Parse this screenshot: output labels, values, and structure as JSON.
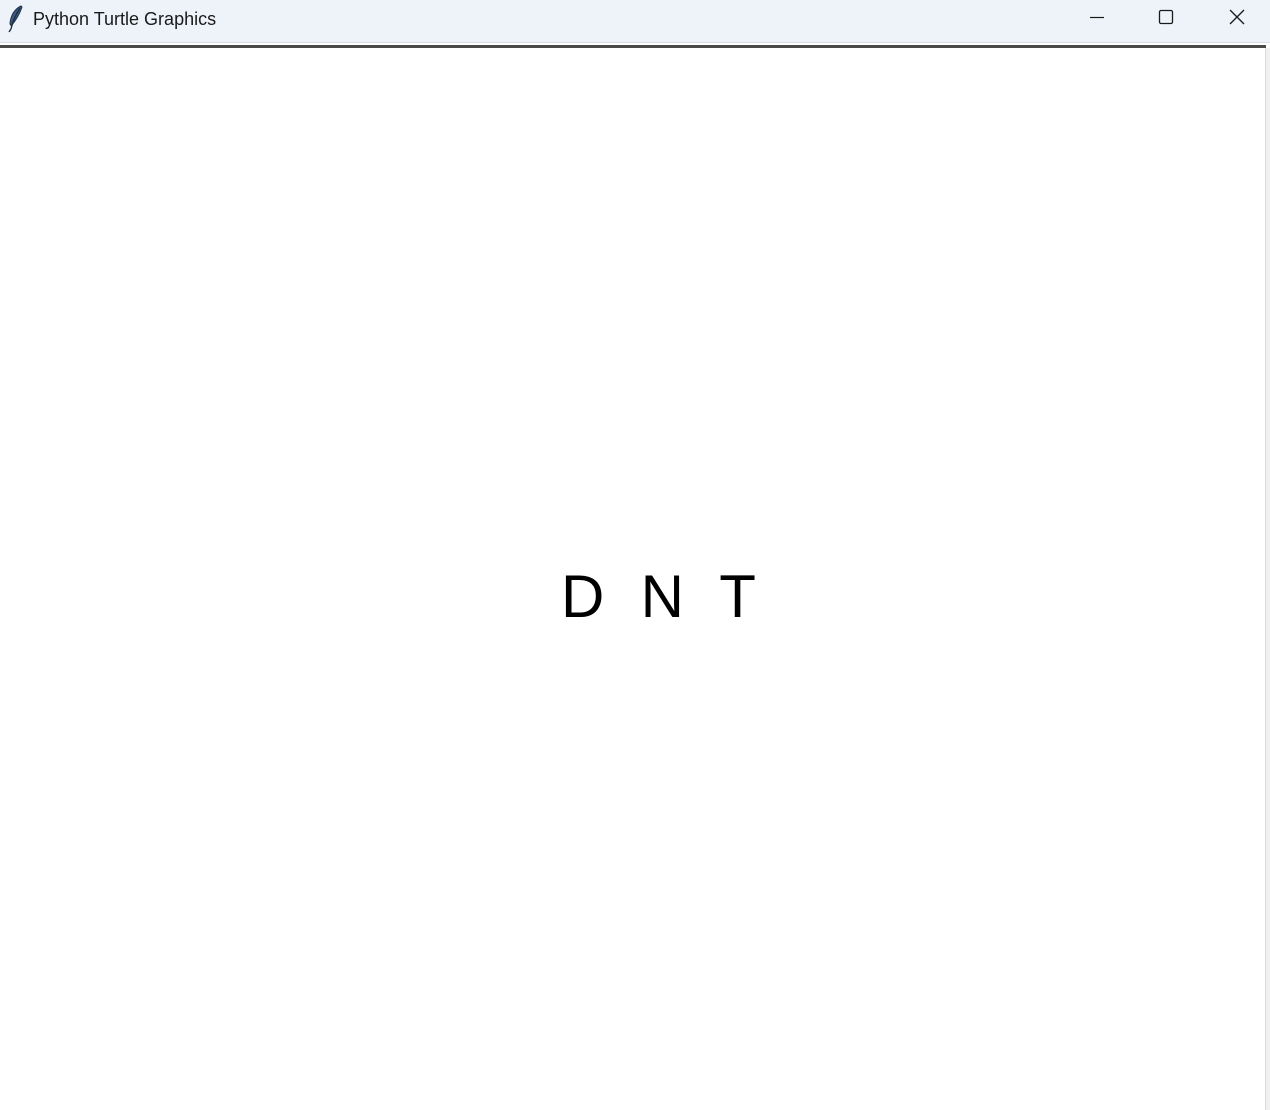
{
  "window": {
    "title": "Python Turtle Graphics",
    "controls": {
      "minimize": "minimize-icon",
      "maximize": "maximize-icon",
      "close": "close-icon"
    },
    "app_icon": "feather-icon"
  },
  "canvas": {
    "background": "#ffffff",
    "drawn_text": "D  N  T",
    "text_color": "#000000"
  }
}
